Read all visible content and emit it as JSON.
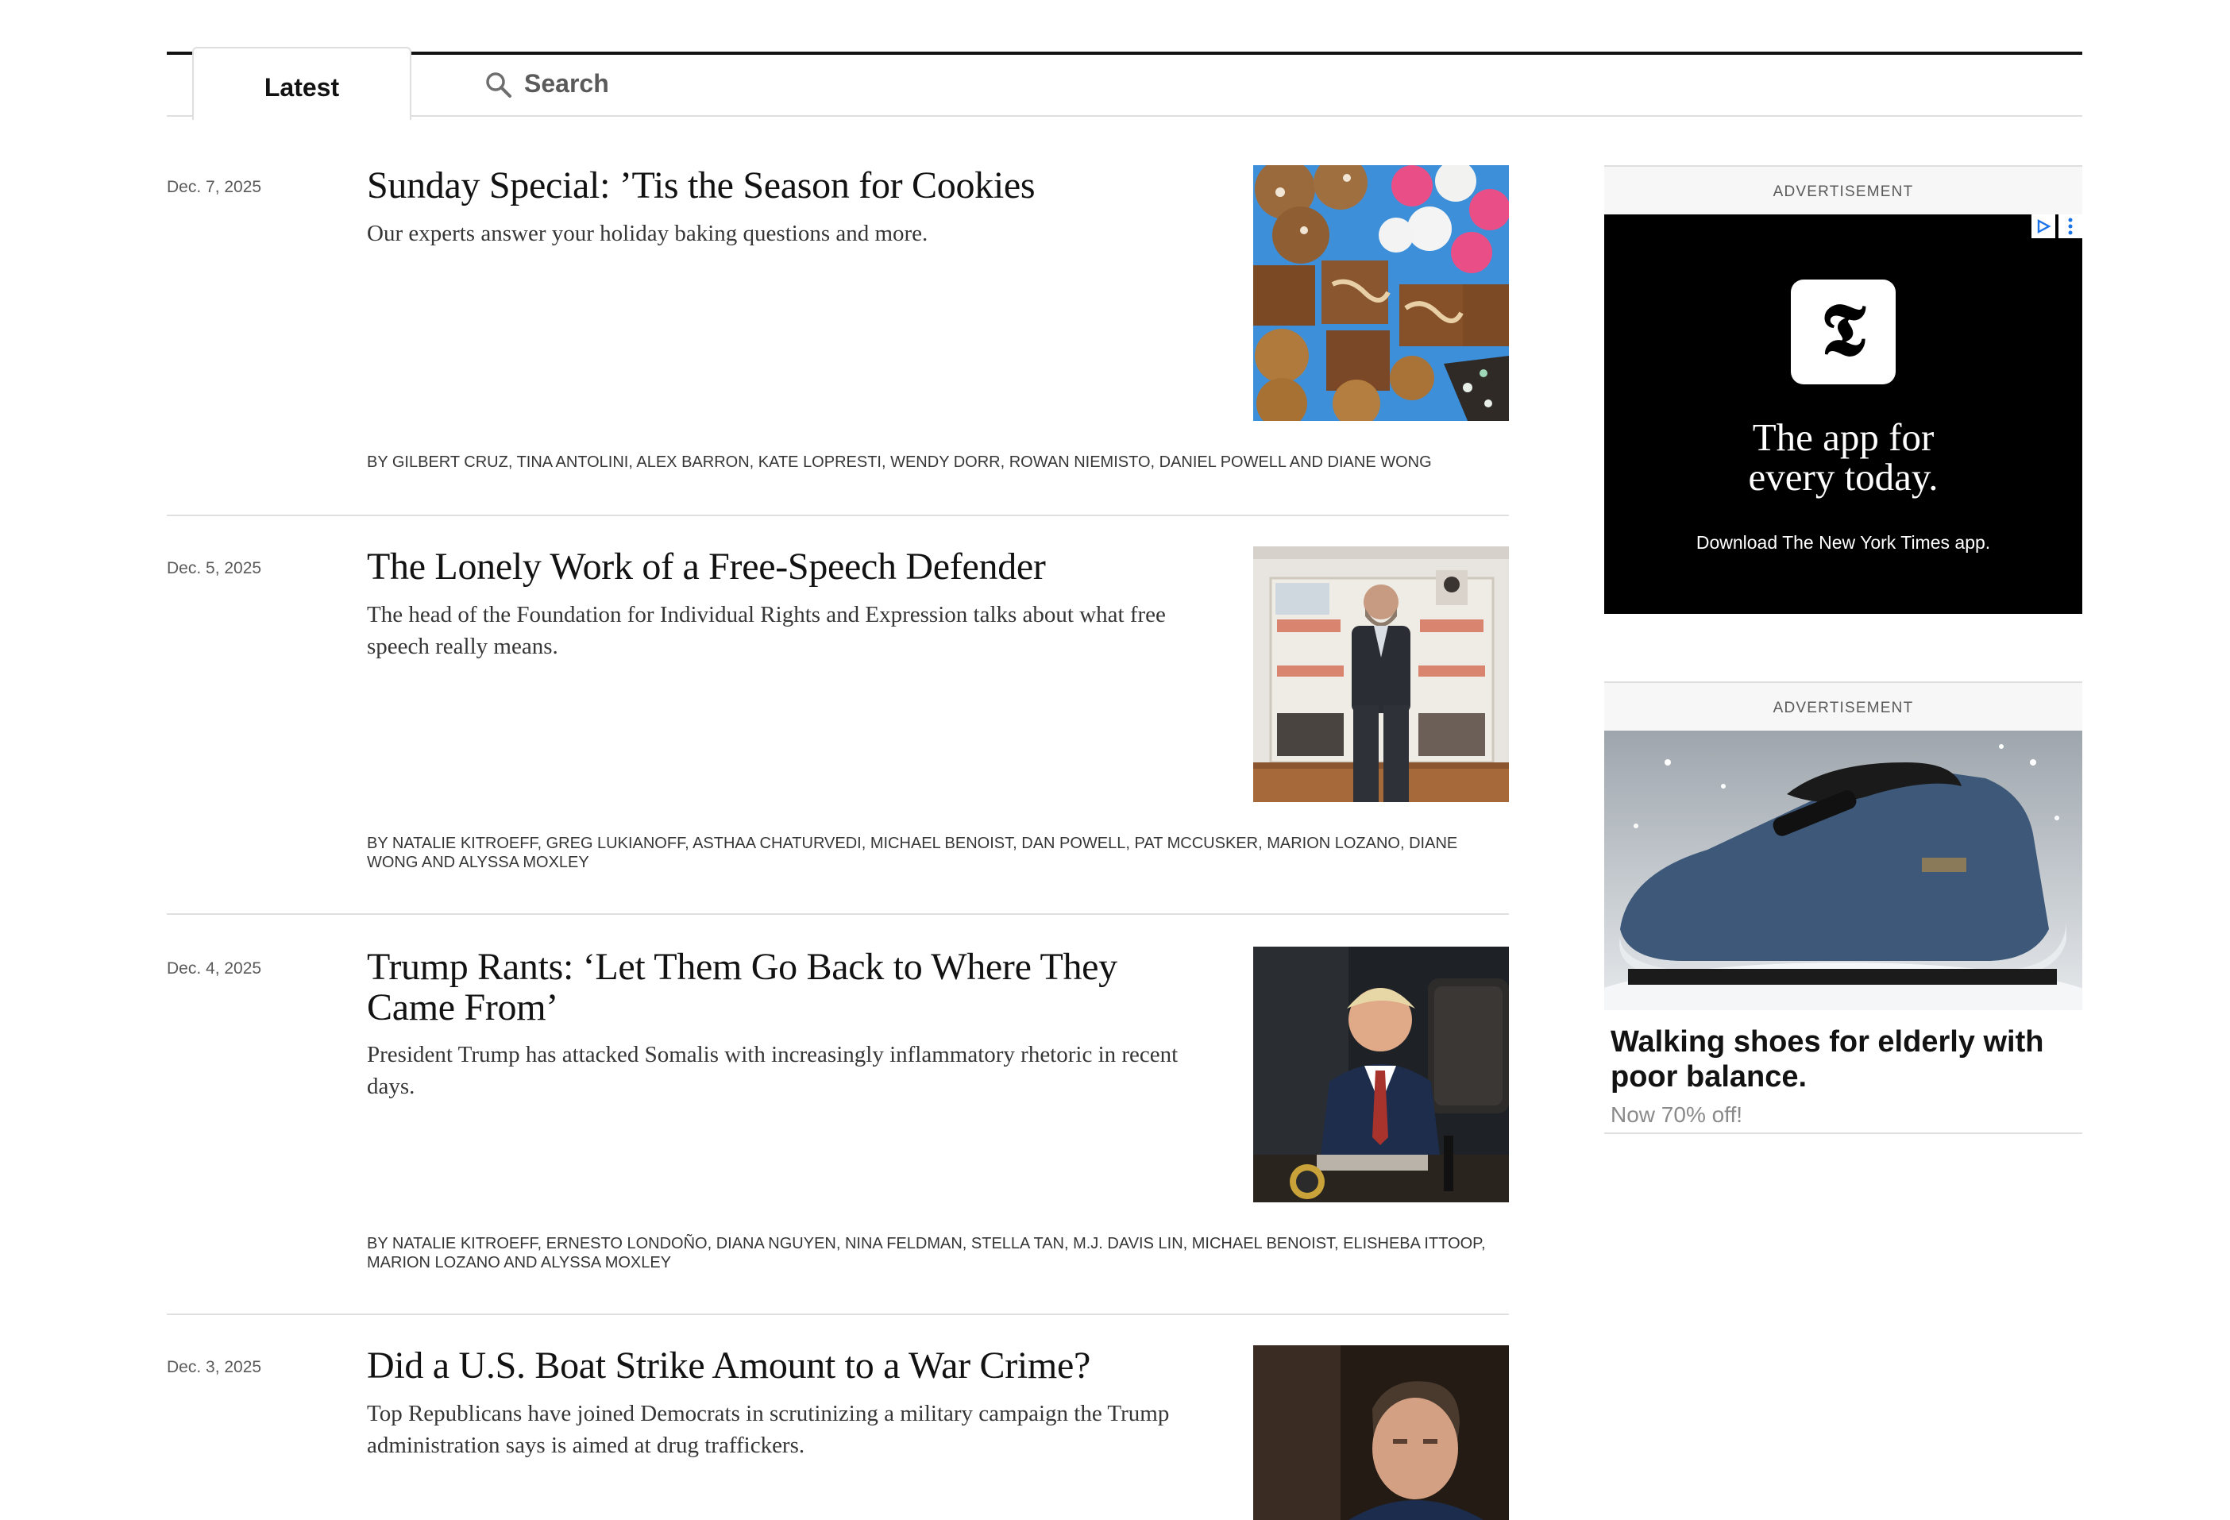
{
  "tabs": {
    "latest_label": "Latest",
    "search_label": "Search"
  },
  "articles": [
    {
      "date": "Dec. 7, 2025",
      "headline": "Sunday Special: ’Tis the Season for Cookies",
      "summary": "Our experts answer your holiday baking questions and more.",
      "byline": "By GILBERT CRUZ, TINA ANTOLINI, ALEX BARRON, KATE LOPRESTI, WENDY DORR, ROWAN NIEMISTO, DANIEL POWELL and DIANE WONG",
      "image": "cookies-and-brownies-photo"
    },
    {
      "date": "Dec. 5, 2025",
      "headline": "The Lonely Work of a Free-Speech Defender",
      "summary": "The head of the Foundation for Individual Rights and Expression talks about what free speech really means.",
      "byline": "By NATALIE KITROEFF, GREG LUKIANOFF, ASTHAA CHATURVEDI, MICHAEL BENOIST, DAN POWELL, PAT MCCUSKER, MARION LOZANO, DIANE WONG and ALYSSA MOXLEY",
      "image": "man-in-library-photo"
    },
    {
      "date": "Dec. 4, 2025",
      "headline": "Trump Rants: ‘Let Them Go Back to Where They Came From’",
      "summary": "President Trump has attacked Somalis with increasingly inflammatory rhetoric in recent days.",
      "byline": "By NATALIE KITROEFF, ERNESTO LONDOÑO, DIANA NGUYEN, NINA FELDMAN, STELLA TAN, M.J. DAVIS LIN, MICHAEL BENOIST, ELISHEBA ITTOOP, MARION LOZANO and ALYSSA MOXLEY",
      "image": "trump-seated-photo"
    },
    {
      "date": "Dec. 3, 2025",
      "headline": "Did a U.S. Boat Strike Amount to a War Crime?",
      "summary": "Top Republicans have joined Democrats in scrutinizing a military campaign the Trump administration says is aimed at drug traffickers.",
      "image": "man-portrait-photo"
    }
  ],
  "ads": [
    {
      "label": "ADVERTISEMENT",
      "logo_glyph": "𝕿",
      "tagline": "The app for\nevery today.",
      "cta": "Download The New York Times app."
    },
    {
      "label": "ADVERTISEMENT",
      "title": "Walking shoes for elderly with poor balance.",
      "subtitle": "Now 70% off!",
      "image": "blue-slip-on-shoe-in-snow"
    }
  ],
  "colors": {
    "text": "#121212",
    "muted": "#5a5a5a",
    "rule": "#dfdfdf",
    "ad_bg": "#000000"
  }
}
